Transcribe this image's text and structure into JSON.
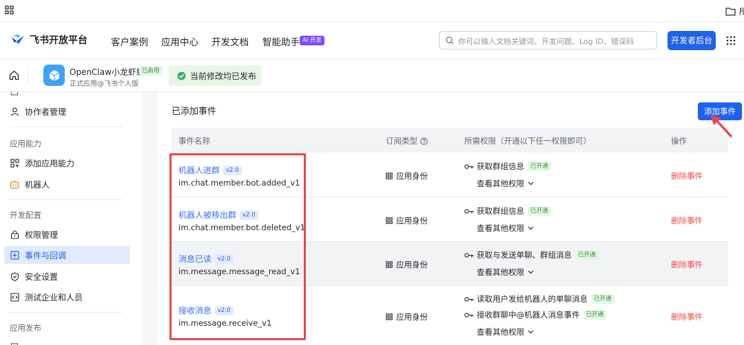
{
  "topbar": {
    "folder_text": "所"
  },
  "header": {
    "brand": "飞书开放平台",
    "nav": [
      "客户案例",
      "应用中心",
      "开发文档",
      "智能助手"
    ],
    "ai_badge": "AI 开发",
    "search_placeholder": "你可以输入文档关键词、开发问题、Log ID、错误码",
    "dev_console_label": "开发者后台"
  },
  "appbar": {
    "app_name": "OpenClaw小龙虾虾",
    "app_status": "已启用",
    "app_subtitle": "正式应用@飞书个人版",
    "publish_notice": "当前修改均已发布"
  },
  "sidebar": {
    "items": [
      {
        "label": "协作者管理",
        "icon": "user-icon"
      },
      {
        "label": "添加应用能力",
        "icon": "grid-add-icon"
      },
      {
        "label": "机器人",
        "icon": "robot-icon"
      },
      {
        "label": "权限管理",
        "icon": "lock-icon"
      },
      {
        "label": "事件与回调",
        "icon": "event-icon",
        "active": true
      },
      {
        "label": "安全设置",
        "icon": "shield-icon"
      },
      {
        "label": "测试企业和人员",
        "icon": "code-icon"
      }
    ],
    "sections": [
      "应用能力",
      "开发配置",
      "应用发布"
    ]
  },
  "main": {
    "section_title": "已添加事件",
    "add_event_label": "添加事件",
    "columns": [
      "事件名称",
      "订阅类型",
      "所需权限（开通以下任一权限即可）",
      "操作"
    ],
    "events": [
      {
        "name": "机器人进群",
        "version": "v2.0",
        "key": "im.chat.member.bot.added_v1",
        "sub_type": "应用身份",
        "perms": [
          {
            "text": "获取群组信息",
            "status": "已开通"
          }
        ],
        "more": "查看其他权限",
        "action": "删除事件"
      },
      {
        "name": "机器人被移出群",
        "version": "v2.0",
        "key": "im.chat.member.bot.deleted_v1",
        "sub_type": "应用身份",
        "perms": [
          {
            "text": "获取群组信息",
            "status": "已开通"
          }
        ],
        "more": "查看其他权限",
        "action": "删除事件"
      },
      {
        "name": "消息已读",
        "version": "v2.0",
        "key": "im.message.message_read_v1",
        "sub_type": "应用身份",
        "perms": [
          {
            "text": "获取与发送单聊、群组消息",
            "status": "已开通"
          }
        ],
        "more": "查看其他权限",
        "action": "删除事件"
      },
      {
        "name": "接收消息",
        "version": "v2.0",
        "key": "im.message.receive_v1",
        "sub_type": "应用身份",
        "perms": [
          {
            "text": "读取用户发给机器人的单聊消息",
            "status": "已开通"
          },
          {
            "text": "接收群聊中@机器人消息事件",
            "status": "已开通"
          }
        ],
        "more": "查看其他权限",
        "action": "删除事件"
      }
    ]
  },
  "colors": {
    "primary": "#1f62eb",
    "link": "#3370ff",
    "danger": "#f54a45",
    "success": "#2ea121",
    "highlight": "#e8474a"
  }
}
